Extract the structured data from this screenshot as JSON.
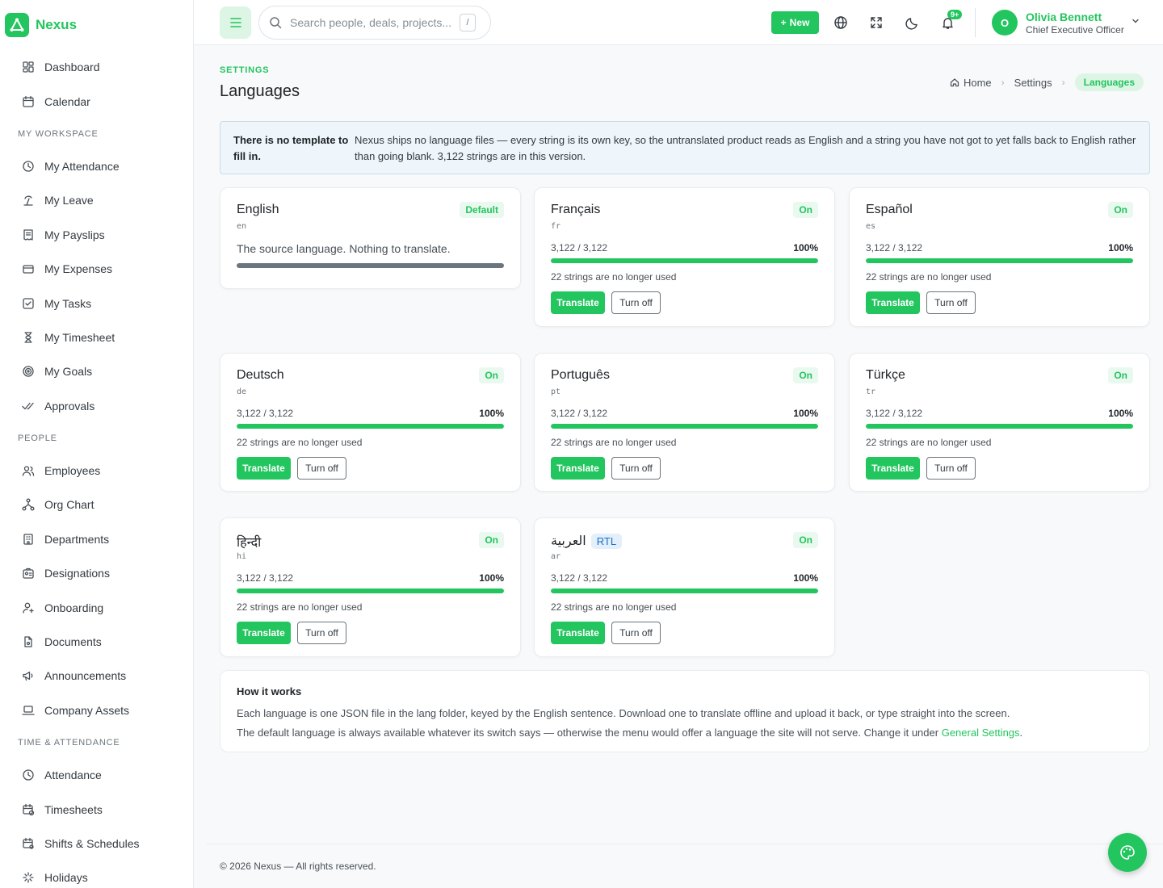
{
  "brand": {
    "name": "Nexus"
  },
  "sidebar": {
    "top": [
      {
        "label": "Dashboard",
        "icon": "dashboard-icon"
      },
      {
        "label": "Calendar",
        "icon": "calendar-icon"
      }
    ],
    "sections": [
      {
        "title": "My Workspace",
        "items": [
          {
            "label": "My Attendance",
            "icon": "clock-icon"
          },
          {
            "label": "My Leave",
            "icon": "beach-icon"
          },
          {
            "label": "My Payslips",
            "icon": "receipt-icon"
          },
          {
            "label": "My Expenses",
            "icon": "wallet-icon"
          },
          {
            "label": "My Tasks",
            "icon": "checkbox-icon"
          },
          {
            "label": "My Timesheet",
            "icon": "hourglass-icon"
          },
          {
            "label": "My Goals",
            "icon": "target-icon"
          },
          {
            "label": "Approvals",
            "icon": "double-check-icon"
          }
        ]
      },
      {
        "title": "People",
        "items": [
          {
            "label": "Employees",
            "icon": "users-icon"
          },
          {
            "label": "Org Chart",
            "icon": "org-chart-icon"
          },
          {
            "label": "Departments",
            "icon": "building-icon"
          },
          {
            "label": "Designations",
            "icon": "badge-icon"
          },
          {
            "label": "Onboarding",
            "icon": "user-plus-icon"
          },
          {
            "label": "Documents",
            "icon": "document-icon"
          },
          {
            "label": "Announcements",
            "icon": "megaphone-icon"
          },
          {
            "label": "Company Assets",
            "icon": "laptop-icon"
          }
        ]
      },
      {
        "title": "Time & Attendance",
        "items": [
          {
            "label": "Attendance",
            "icon": "clock-icon"
          },
          {
            "label": "Timesheets",
            "icon": "calendar-clock-icon"
          },
          {
            "label": "Shifts & Schedules",
            "icon": "calendar-settings-icon"
          },
          {
            "label": "Holidays",
            "icon": "sparkle-icon"
          }
        ]
      }
    ]
  },
  "topbar": {
    "search_placeholder": "Search people, deals, projects...",
    "search_shortcut": "/",
    "new_label": "New",
    "notification_count": "9+",
    "user": {
      "initial": "O",
      "name": "Olivia Bennett",
      "role": "Chief Executive Officer"
    }
  },
  "page": {
    "eyebrow": "SETTINGS",
    "title": "Languages",
    "breadcrumb": [
      "Home",
      "Settings",
      "Languages"
    ]
  },
  "alert": {
    "title": "There is no template to fill in.",
    "text": "Nexus ships no language files — every string is its own key, so the untranslated product reads as English and a string you have not got to yet falls back to English rather than going blank. 3,122 strings are in this version."
  },
  "languages": [
    {
      "name": "English",
      "code": "en",
      "badge": "Default",
      "source_text": "The source language. Nothing to translate."
    },
    {
      "name": "Français",
      "code": "fr",
      "badge": "On",
      "progress": "3,122 / 3,122",
      "percent": "100%",
      "fill": 1.0,
      "unused": "22 strings are no longer used",
      "translate": "Translate",
      "turn_off": "Turn off"
    },
    {
      "name": "Español",
      "code": "es",
      "badge": "On",
      "progress": "3,122 / 3,122",
      "percent": "100%",
      "fill": 1.0,
      "unused": "22 strings are no longer used",
      "translate": "Translate",
      "turn_off": "Turn off"
    },
    {
      "name": "Deutsch",
      "code": "de",
      "badge": "On",
      "progress": "3,122 / 3,122",
      "percent": "100%",
      "fill": 1.0,
      "unused": "22 strings are no longer used",
      "translate": "Translate",
      "turn_off": "Turn off"
    },
    {
      "name": "Português",
      "code": "pt",
      "badge": "On",
      "progress": "3,122 / 3,122",
      "percent": "100%",
      "fill": 1.0,
      "unused": "22 strings are no longer used",
      "translate": "Translate",
      "turn_off": "Turn off"
    },
    {
      "name": "Türkçe",
      "code": "tr",
      "badge": "On",
      "progress": "3,122 / 3,122",
      "percent": "100%",
      "fill": 1.0,
      "unused": "22 strings are no longer used",
      "translate": "Translate",
      "turn_off": "Turn off"
    },
    {
      "name": "हिन्दी",
      "code": "hi",
      "badge": "On",
      "progress": "3,122 / 3,122",
      "percent": "100%",
      "fill": 1.0,
      "unused": "22 strings are no longer used",
      "translate": "Translate",
      "turn_off": "Turn off"
    },
    {
      "name": "العربية",
      "code": "ar",
      "rtl": "RTL",
      "badge": "On",
      "progress": "3,122 / 3,122",
      "percent": "100%",
      "fill": 1.0,
      "unused": "22 strings are no longer used",
      "translate": "Translate",
      "turn_off": "Turn off"
    }
  ],
  "how": {
    "title": "How it works",
    "line1": "Each language is one JSON file in the lang folder, keyed by the English sentence. Download one to translate offline and upload it back, or type straight into the screen.",
    "line2_prefix": "The default language is always available whatever its switch says — otherwise the menu would offer a language the site will not serve. Change it under ",
    "line2_link": "General Settings",
    "line2_suffix": "."
  },
  "footer": {
    "text": "© 2026 Nexus — All rights reserved."
  },
  "colors": {
    "accent": "#22c55e",
    "accent_soft": "#dcf5e4",
    "info_bg": "#eef6fb"
  }
}
